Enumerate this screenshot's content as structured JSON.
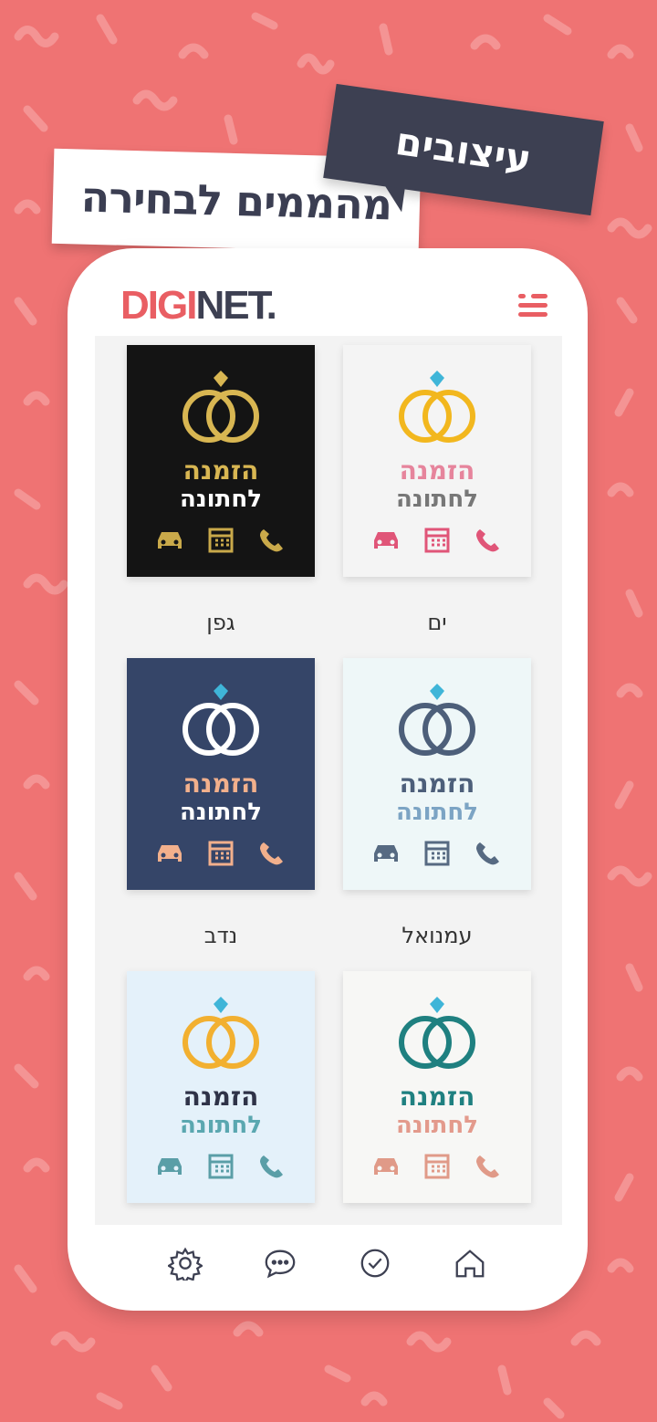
{
  "banner": {
    "main": "עיצובים",
    "sub": "מהממים לבחירה"
  },
  "app": {
    "logo_part1": "DIGI",
    "logo_part2": "NET.",
    "menu_icon": "hamburger-menu-icon"
  },
  "cards": [
    {
      "name": "ים",
      "line1": "הזמנה",
      "line2": "לחתונה",
      "bg": "#f4f4f4",
      "line1_color": "#e6849c",
      "line2_color": "#777777",
      "icon_color": "#e05578",
      "ring_color": "#f2b71e"
    },
    {
      "name": "גפן",
      "line1": "הזמנה",
      "line2": "לחתונה",
      "bg": "#141414",
      "line1_color": "#d8b652",
      "line2_color": "#ffffff",
      "icon_color": "#c9a94a",
      "ring_color": "#d8b652"
    },
    {
      "name": "עמנואל",
      "line1": "הזמנה",
      "line2": "לחתונה",
      "bg": "#eef7f8",
      "line1_color": "#4d5f7a",
      "line2_color": "#7ca4c4",
      "icon_color": "#566a82",
      "ring_color": "#4d5f7a"
    },
    {
      "name": "נדב",
      "line1": "הזמנה",
      "line2": "לחתונה",
      "bg": "#354568",
      "line1_color": "#f2b08c",
      "line2_color": "#ffffff",
      "icon_color": "#f2b08c",
      "ring_color": "#ffffff"
    },
    {
      "name": "",
      "line1": "הזמנה",
      "line2": "לחתונה",
      "bg": "#f7f7f5",
      "line1_color": "#1f8080",
      "line2_color": "#e39a8c",
      "icon_color": "#e09a88",
      "ring_color": "#1f8080"
    },
    {
      "name": "",
      "line1": "הזמנה",
      "line2": "לחתונה",
      "bg": "#e4f1fa",
      "line1_color": "#2f3348",
      "line2_color": "#5aa7b0",
      "icon_color": "#5a9ea7",
      "ring_color": "#f2b030"
    }
  ],
  "nav": [
    "settings-gear-icon",
    "chat-bubble-icon",
    "check-circle-icon",
    "home-icon"
  ],
  "colors": {
    "background": "#ef7373",
    "accent": "#e95e63",
    "dark": "#3d4052"
  }
}
